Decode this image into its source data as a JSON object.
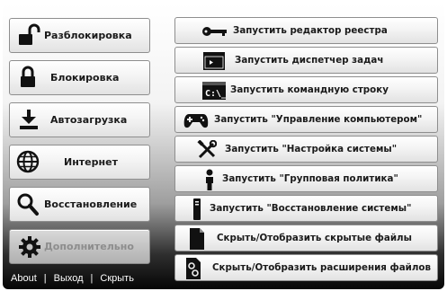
{
  "left_buttons": [
    {
      "label": "Разблокировка",
      "icon": "unlock-icon"
    },
    {
      "label": "Блокировка",
      "icon": "lock-icon"
    },
    {
      "label": "Автозагрузка",
      "icon": "download-tray-icon"
    },
    {
      "label": "Интернет",
      "icon": "globe-icon"
    },
    {
      "label": "Восстановление",
      "icon": "magnifier-icon"
    },
    {
      "label": "Дополнительно",
      "icon": "gear-icon",
      "disabled": true
    }
  ],
  "right_buttons": [
    {
      "label": "Запустить редактор реестра",
      "icon": "key-icon"
    },
    {
      "label": "Запустить диспетчер задач",
      "icon": "task-manager-window-icon"
    },
    {
      "label": "Запустить командную строку",
      "icon": "command-prompt-icon"
    },
    {
      "label": "Запустить \"Управление компьютером\"",
      "icon": "gamepad-icon"
    },
    {
      "label": "Запустить \"Настройка системы\"",
      "icon": "tools-icon"
    },
    {
      "label": "Запустить \"Групповая политика\"",
      "icon": "person-icon"
    },
    {
      "label": "Запустить \"Восстановление системы\"",
      "icon": "tower-pc-icon"
    },
    {
      "label": "Скрыть/Отобразить скрытые файлы",
      "icon": "file-icon"
    },
    {
      "label": "Скрыть/Отобразить расширения файлов",
      "icon": "file-settings-icon"
    }
  ],
  "footer": {
    "about": "About",
    "separator": "|",
    "exit": "Выход",
    "hide": "Скрыть"
  },
  "icon_cmd_text": "C:\\_",
  "colors": {
    "background_bottom": "#050505",
    "disabled_text": "#8d8d8d",
    "footer_text": "#ffffff"
  }
}
